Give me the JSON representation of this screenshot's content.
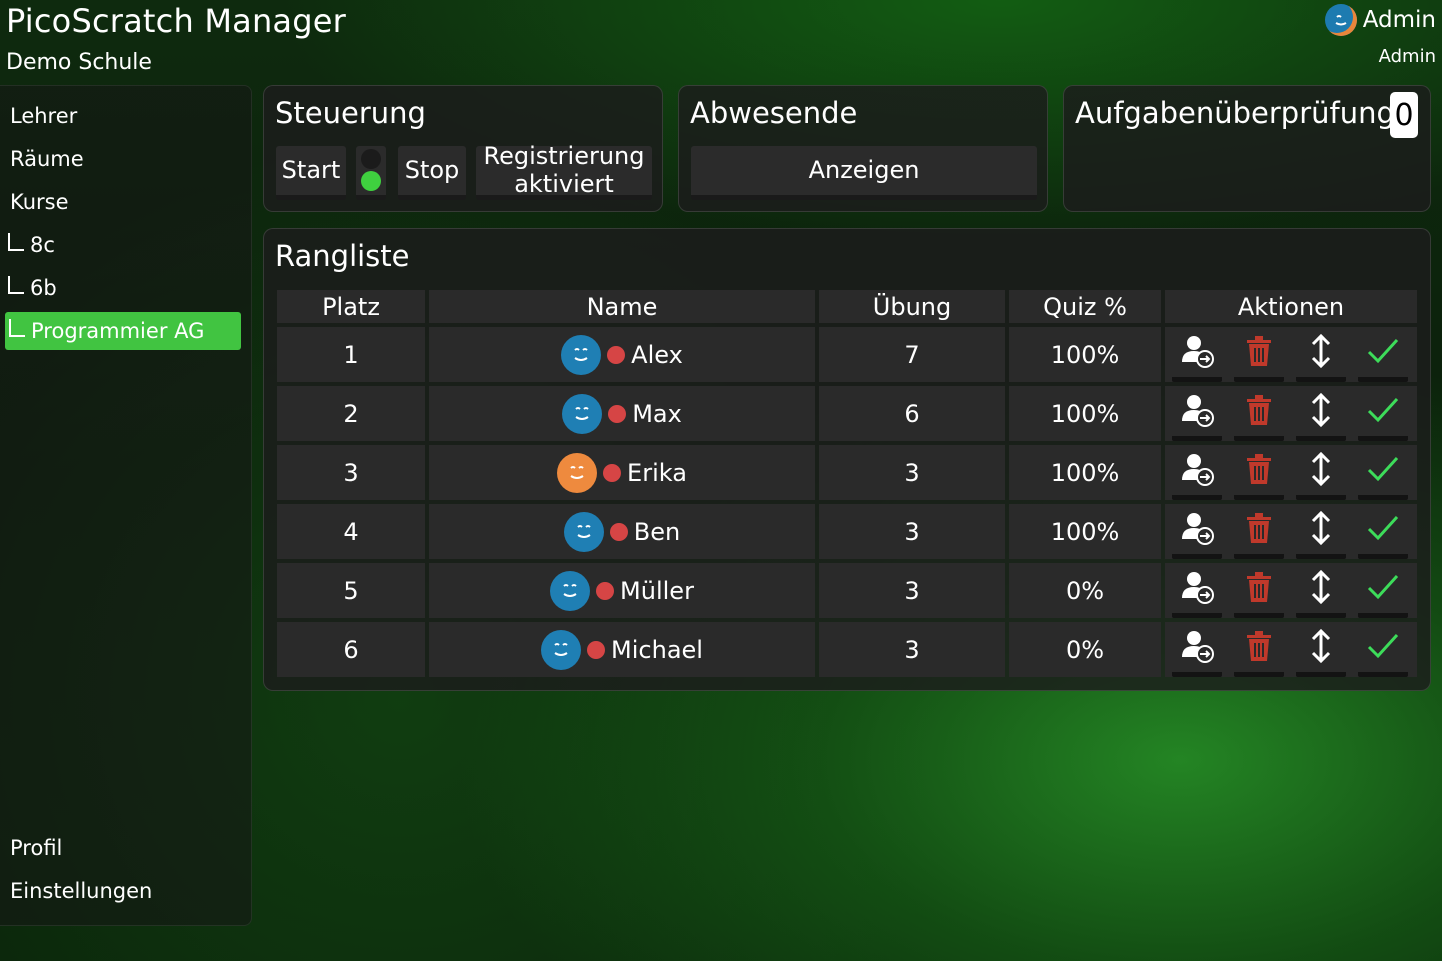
{
  "header": {
    "title": "PicoScratch Manager",
    "subtitle": "Demo Schule",
    "user_name": "Admin",
    "user_role": "Admin"
  },
  "sidebar": {
    "items": [
      {
        "label": "Lehrer"
      },
      {
        "label": "Räume"
      },
      {
        "label": "Kurse"
      },
      {
        "label": "8c"
      },
      {
        "label": "6b"
      },
      {
        "label": "Programmier AG",
        "active": true
      }
    ],
    "bottom_items": [
      {
        "label": "Profil"
      },
      {
        "label": "Einstellungen"
      }
    ]
  },
  "control": {
    "title": "Steuerung",
    "start_label": "Start",
    "stop_label": "Stop",
    "registration_line1": "Registrierung",
    "registration_line2": "aktiviert",
    "status_light": "green"
  },
  "absent": {
    "title": "Abwesende",
    "button_label": "Anzeigen"
  },
  "task_review": {
    "title": "Aufgabenüberprüfung",
    "count": "0"
  },
  "ranking": {
    "title": "Rangliste",
    "columns": [
      "Platz",
      "Name",
      "Übung",
      "Quiz %",
      "Aktionen"
    ],
    "rows": [
      {
        "place": "1",
        "name": "Alex",
        "exercise": "7",
        "quiz": "100%",
        "avatar_color": "#1f7fb4"
      },
      {
        "place": "2",
        "name": "Max",
        "exercise": "6",
        "quiz": "100%",
        "avatar_color": "#1f7fb4"
      },
      {
        "place": "3",
        "name": "Erika",
        "exercise": "3",
        "quiz": "100%",
        "avatar_color": "#ee8a3e"
      },
      {
        "place": "4",
        "name": "Ben",
        "exercise": "3",
        "quiz": "100%",
        "avatar_color": "#1f7fb4"
      },
      {
        "place": "5",
        "name": "Müller",
        "exercise": "3",
        "quiz": "0%",
        "avatar_color": "#1f7fb4"
      },
      {
        "place": "6",
        "name": "Michael",
        "exercise": "3",
        "quiz": "0%",
        "avatar_color": "#1f7fb4"
      }
    ],
    "actions": [
      "move-user-icon",
      "trash-icon",
      "swap-vertical-icon",
      "check-icon"
    ],
    "status_dot_color": "#d64545"
  },
  "colors": {
    "accent": "#41c441",
    "danger": "#c0392b",
    "check": "#3ddc5a"
  }
}
